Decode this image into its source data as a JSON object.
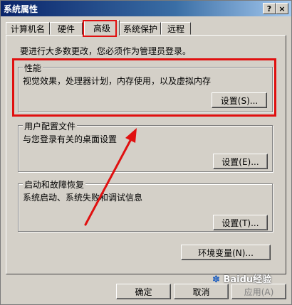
{
  "window": {
    "title": "系统属性",
    "help": "?",
    "close": "×"
  },
  "tabs": [
    {
      "label": "计算机名"
    },
    {
      "label": "硬件"
    },
    {
      "label": "高级"
    },
    {
      "label": "系统保护"
    },
    {
      "label": "远程"
    }
  ],
  "notice": "要进行大多数更改，您必须作为管理员登录。",
  "performance": {
    "legend": "性能",
    "desc": "视觉效果，处理器计划，内存使用，以及虚拟内存",
    "button": "设置(S)..."
  },
  "user_profiles": {
    "legend": "用户配置文件",
    "desc": "与您登录有关的桌面设置",
    "button": "设置(E)..."
  },
  "startup": {
    "legend": "启动和故障恢复",
    "desc": "系统启动、系统失败和调试信息",
    "button": "设置(T)..."
  },
  "env_button": "环境变量(N)...",
  "footer": {
    "ok": "确定",
    "cancel": "取消",
    "apply": "应用(A)"
  },
  "watermark": "Baidu经验",
  "colors": {
    "annotation": "#e01010",
    "titlebar": "#0a246a"
  }
}
